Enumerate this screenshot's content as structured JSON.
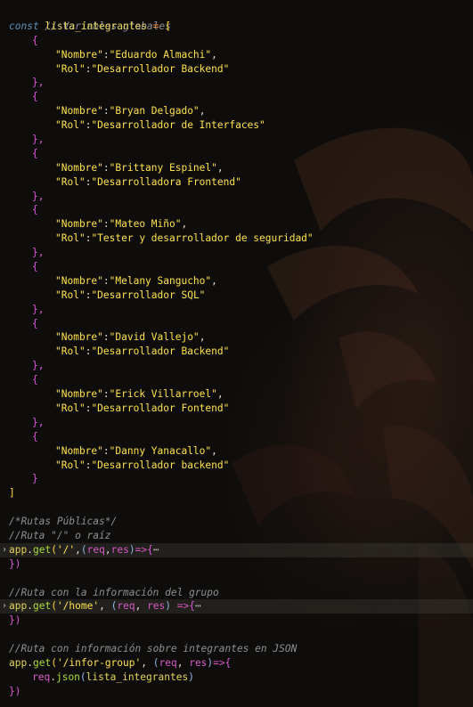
{
  "colors": {
    "background": "#0e0d0c",
    "comment": "#8f8f8f",
    "keyword": "#5f8fb5",
    "variable": "#e5d45a",
    "string": "#ffe14d",
    "bracket": "#ffd033",
    "brace": "#d957d9",
    "function": "#a7dd3a",
    "param": "#d958c9"
  },
  "code": {
    "l1_comment": "// Variables globales",
    "l2_const": "const",
    "l2_name": "lista_integrantes",
    "l2_eq": "=",
    "open_bracket": "[",
    "close_bracket": "]",
    "open_brace": "{",
    "close_brace": "}",
    "close_brace_comma": "},",
    "key_nombre": "\"Nombre\"",
    "key_rol": "\"Rol\"",
    "colon": ":",
    "comma": ",",
    "members": [
      {
        "nombre": "\"Eduardo Almachi\"",
        "rol": "\"Desarrollador Backend\""
      },
      {
        "nombre": "\"Bryan Delgado\"",
        "rol": "\"Desarrollador de Interfaces\""
      },
      {
        "nombre": "\"Brittany Espinel\"",
        "rol": "\"Desarrolladora Frontend\""
      },
      {
        "nombre": "\"Mateo Miño\"",
        "rol": "\"Tester y desarrollador de seguridad\""
      },
      {
        "nombre": "\"Melany Sangucho\"",
        "rol": "\"Desarrollador SQL\""
      },
      {
        "nombre": "\"David Vallejo\"",
        "rol": "\"Desarrollador Backend\""
      },
      {
        "nombre": "\"Erick Villarroel\"",
        "rol": "\"Desarrollador Fontend\""
      },
      {
        "nombre": "\"Danny Yanacallo\"",
        "rol": "\"Desarrollador backend\""
      }
    ],
    "c_rutas_publicas": "/*Rutas Públicas*/",
    "c_ruta_raiz": "//Ruta \"/\" o raíz",
    "c_ruta_home": "//Ruta con la información del grupo",
    "c_ruta_json": "//Ruta con información sobre integrantes en JSON",
    "app": "app",
    "dot": ".",
    "get": "get",
    "lparen": "(",
    "rparen": ")",
    "path_root": "'/'",
    "path_home": "'/home'",
    "path_infor": "'/infor-group'",
    "req": "req",
    "res": "res",
    "arrow": "=>",
    "ellipsis": "⋯",
    "close_paren_line": "})",
    "json_method": "json",
    "json_arg": "lista_integrantes",
    "fold_arrow": "›"
  }
}
